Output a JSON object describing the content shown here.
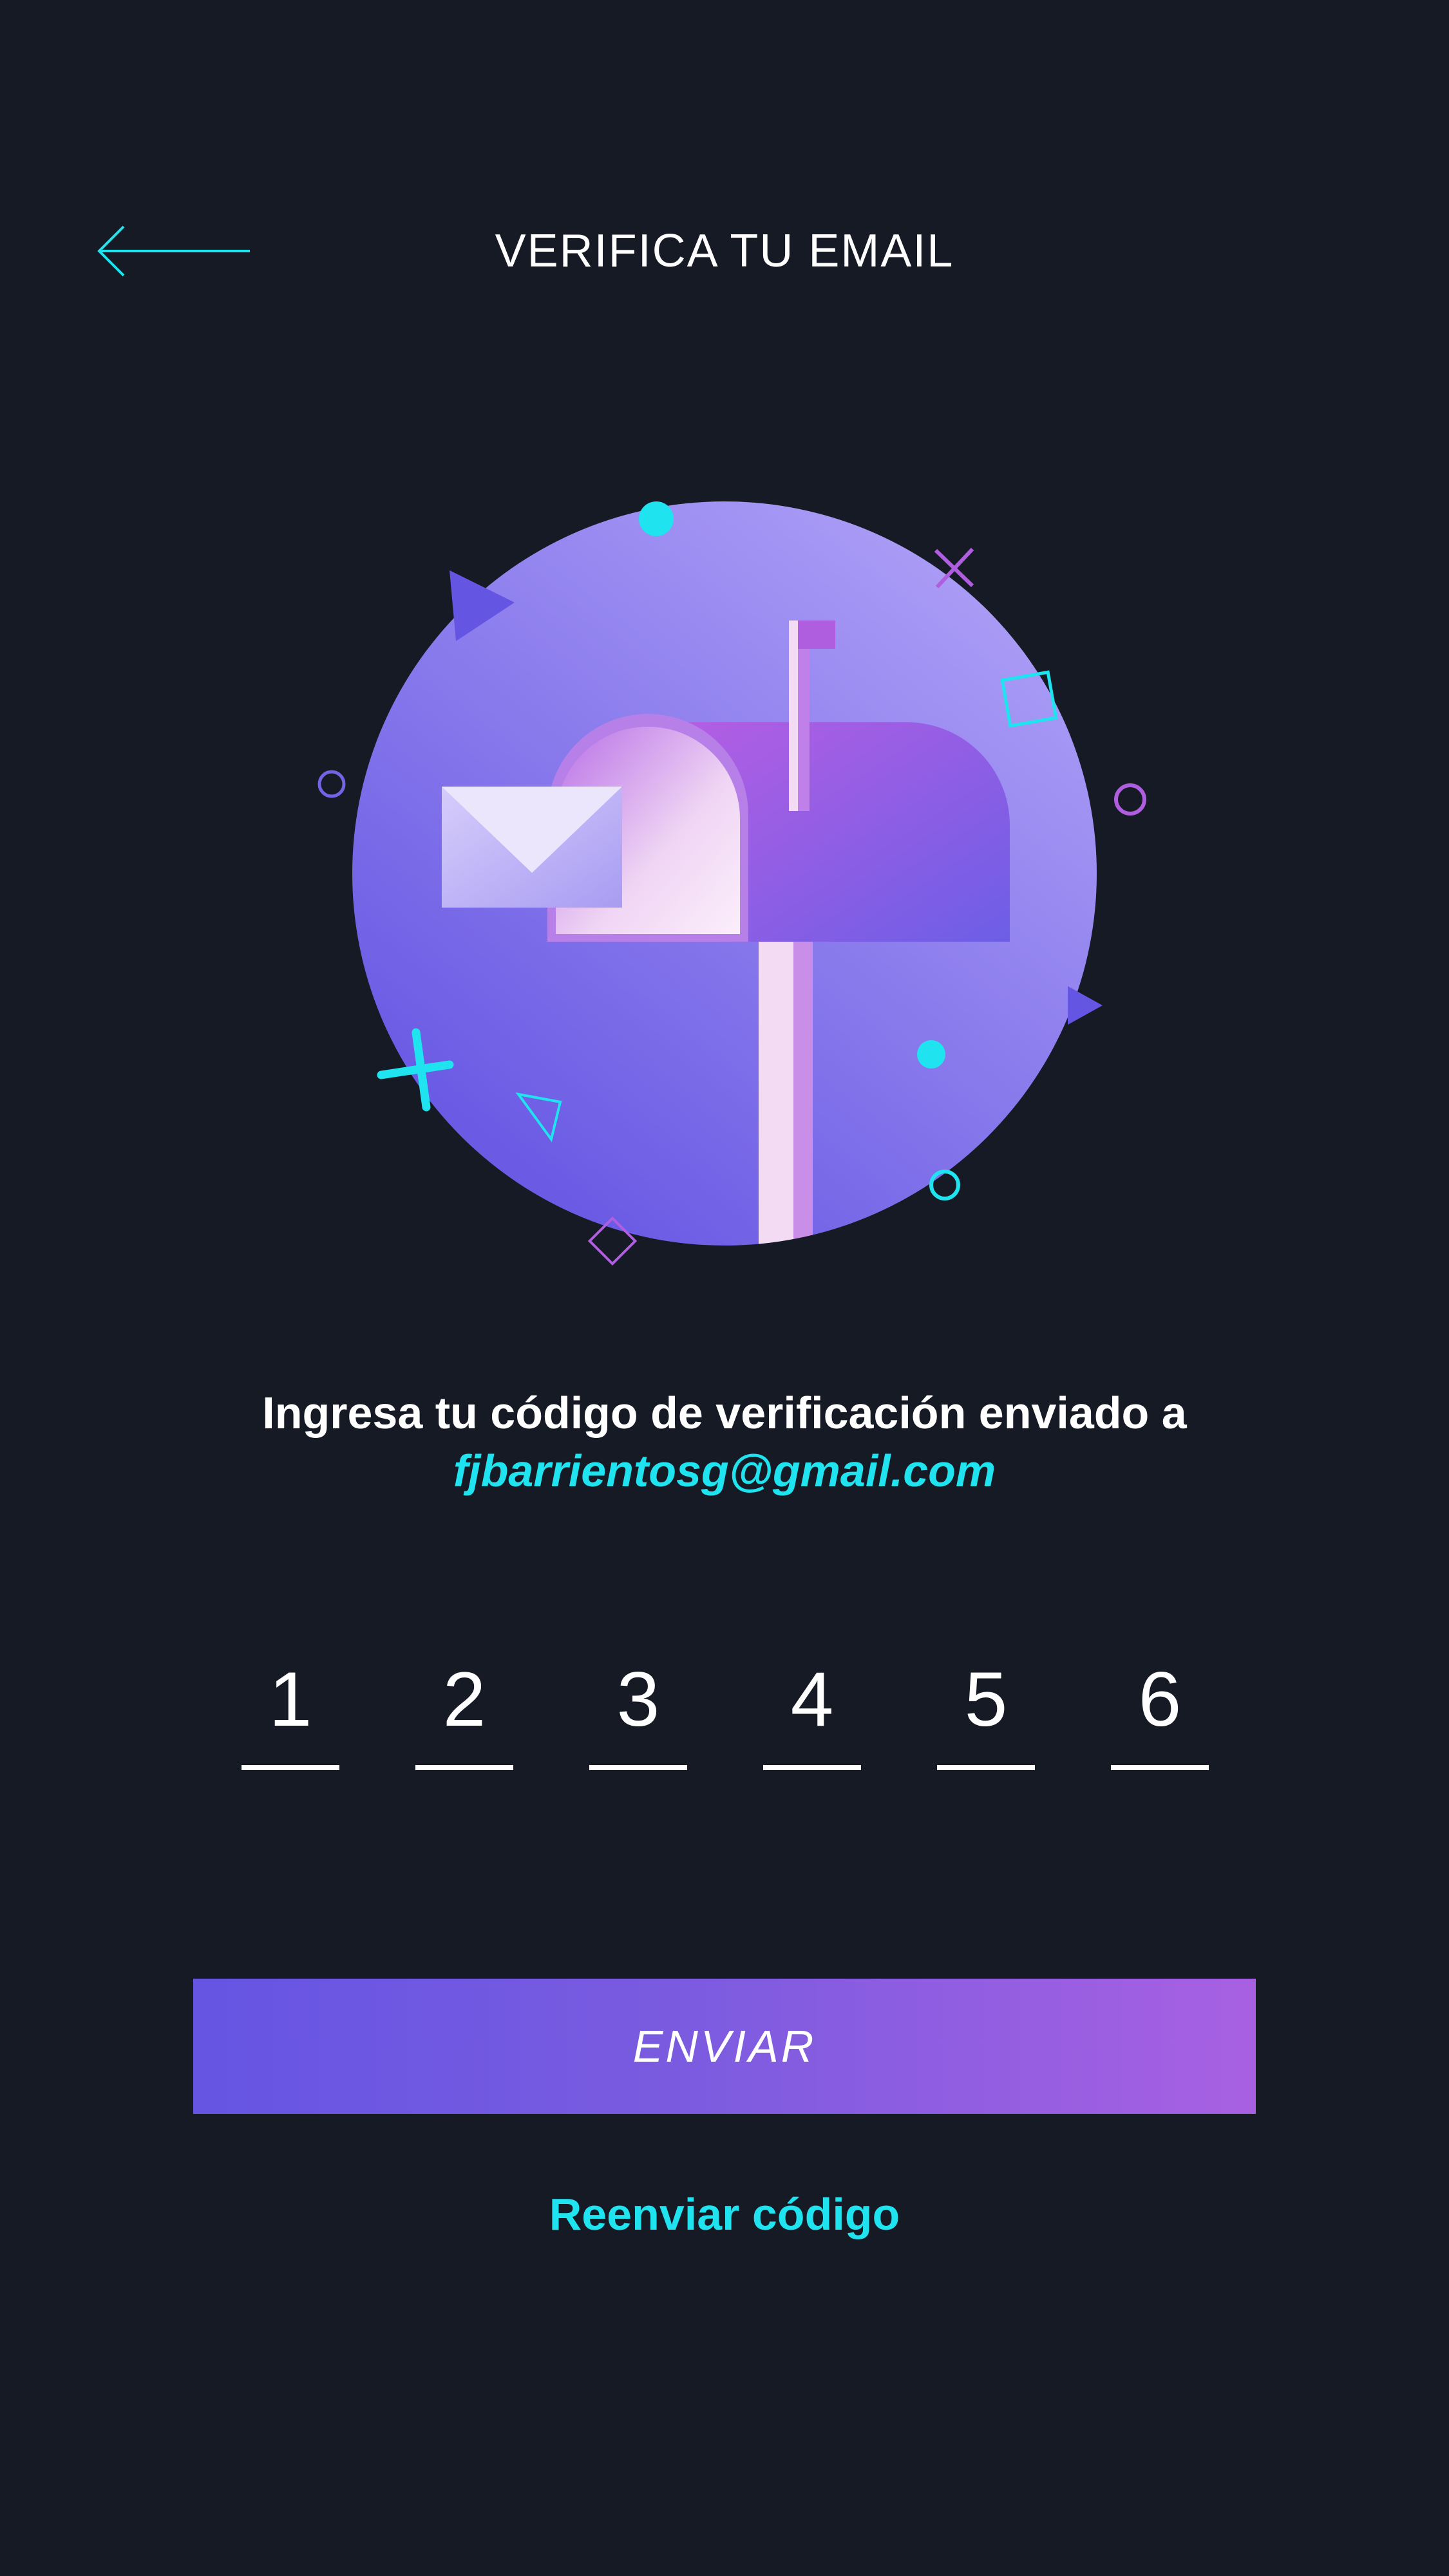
{
  "header": {
    "title": "VERIFICA TU EMAIL",
    "back_icon": "arrow-left-icon"
  },
  "illustration": {
    "subject": "mailbox-with-envelope",
    "colors": {
      "circle_light": "#a99cf5",
      "circle_dark": "#6c5de3",
      "cyan": "#1fe3ef",
      "magenta": "#b05ee0"
    }
  },
  "instruction": {
    "text": "Ingresa tu código de verificación enviado a",
    "email": "fjbarrientosg@gmail.com"
  },
  "code": {
    "digits": [
      "1",
      "2",
      "3",
      "4",
      "5",
      "6"
    ]
  },
  "actions": {
    "submit_label": "ENVIAR",
    "resend_label": "Reenviar código"
  },
  "colors": {
    "background": "#161a25",
    "accent": "#1fe3ef",
    "button_start": "#6555e3",
    "button_end": "#a860e2",
    "text": "#ffffff"
  }
}
